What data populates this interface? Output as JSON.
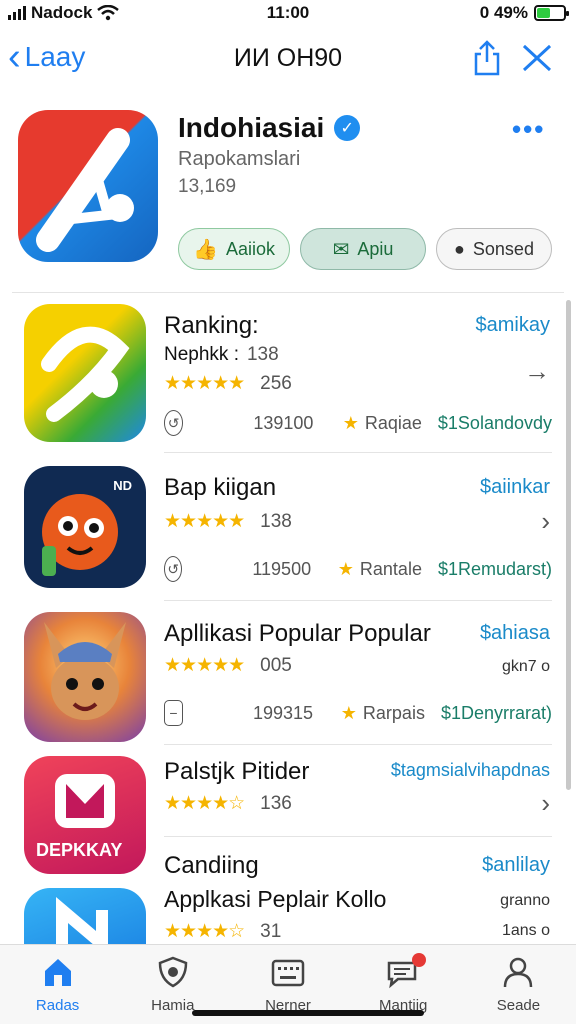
{
  "status": {
    "carrier": "Nadock",
    "time": "11:00",
    "battery_text": "0 49%",
    "battery_level": 0.49
  },
  "nav": {
    "back_label": "Laay",
    "title": "ИИ OH90"
  },
  "hero": {
    "app_name": "Indohiasiai",
    "subtitle": "Rapokamslari",
    "count": "13,169",
    "buttons": [
      {
        "label": "Aaiiok",
        "icon": "thumb-icon"
      },
      {
        "label": "Apiu",
        "icon": "mail-icon"
      },
      {
        "label": "Sonsed",
        "icon": "pin-icon"
      }
    ]
  },
  "list": [
    {
      "title": "Ranking:",
      "price": "$amikay",
      "meta_label": "Nephkk :",
      "meta_value": "138",
      "rating_stars": 4.5,
      "rating_value": "256",
      "downloads": "139100",
      "tag": "Raqiae",
      "green": "$1Solandovdy"
    },
    {
      "title": "Bap kiigan",
      "price": "$aiinkar",
      "rating_stars": 4.5,
      "rating_value": "138",
      "downloads": "119500",
      "tag": "Rantale",
      "green": "$1Remudarst)"
    },
    {
      "title": "Apllikasi Popular Popular",
      "price": "$ahiasa",
      "rating_stars": 4.5,
      "rating_value": "005",
      "side_text": "gkn7 o",
      "downloads": "199315",
      "tag": "Rarpais",
      "green": "$1Denyrrarat)"
    },
    {
      "title": "Palstjk Pitider",
      "price": "$tagmsialvihapdnas",
      "rating_stars": 4,
      "rating_value": "136"
    },
    {
      "title": "Candiing",
      "title2": "Applkasi Peplair Kollo",
      "price": "$anlilay",
      "side_text": "granno",
      "side_text2": "1ans o",
      "rating_stars": 4,
      "rating_value": "31"
    }
  ],
  "tabs": [
    {
      "label": "Radas",
      "icon": "home-icon",
      "active": true
    },
    {
      "label": "Hamia",
      "icon": "shield-icon",
      "active": false
    },
    {
      "label": "Nerner",
      "icon": "keyboard-icon",
      "active": false
    },
    {
      "label": "Mantiig",
      "icon": "messages-icon",
      "active": false
    },
    {
      "label": "Seade",
      "icon": "person-icon",
      "active": false
    }
  ],
  "colors": {
    "accent": "#1f7ef0",
    "price": "#1a8ac9",
    "star": "#f5b400",
    "green_text": "#1a7d68"
  },
  "icon_labels": {
    "partner_badge": "DEPKKAY",
    "small_tag": "ND"
  }
}
